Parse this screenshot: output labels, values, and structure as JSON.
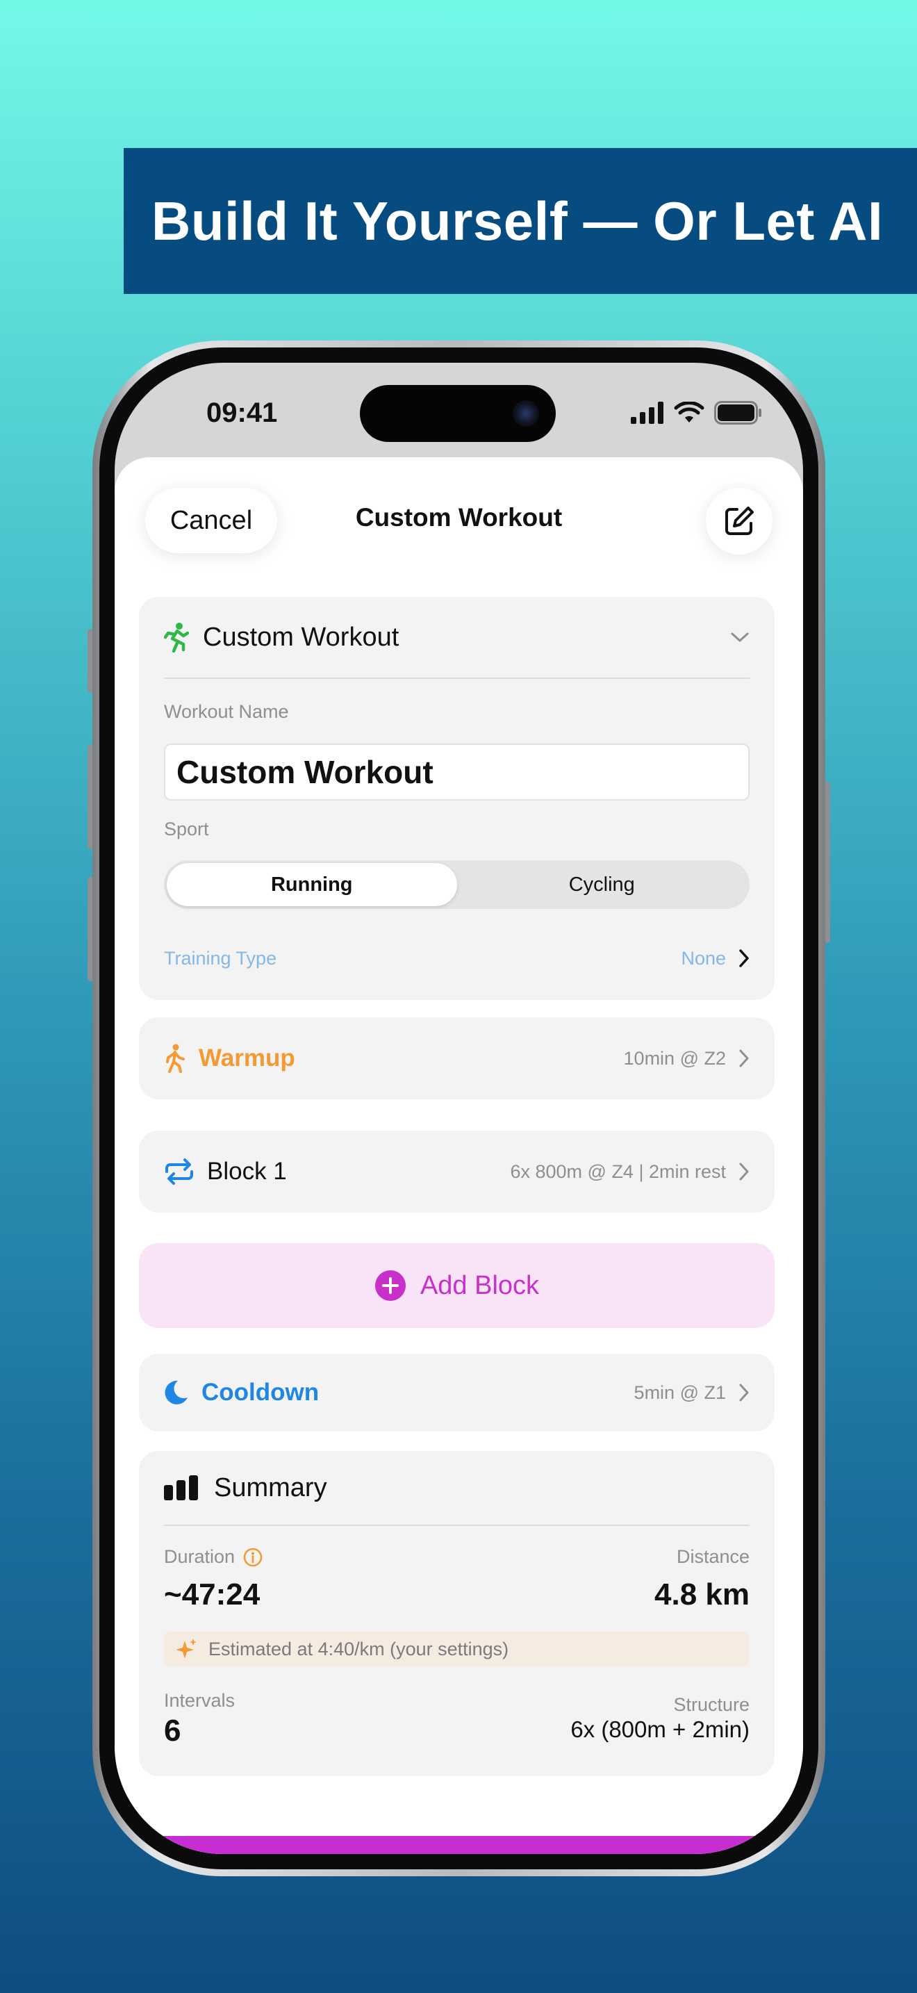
{
  "banner": {
    "headline": "Build It Yourself — Or Let AI"
  },
  "status_bar": {
    "time": "09:41"
  },
  "nav": {
    "cancel_label": "Cancel",
    "title": "Custom Workout",
    "edit_icon": "compose-icon"
  },
  "details": {
    "header_title": "Custom Workout",
    "header_icon": "running-figure-icon",
    "workout_name_label": "Workout Name",
    "workout_name_value": "Custom Workout",
    "sport_label": "Sport",
    "sport_options": [
      "Running",
      "Cycling"
    ],
    "sport_selected": "Running",
    "training_type_label": "Training Type",
    "training_type_value": "None"
  },
  "steps": {
    "warmup": {
      "name": "Warmup",
      "meta": "10min @ Z2",
      "icon": "walking-figure-icon"
    },
    "block1": {
      "name": "Block 1",
      "meta": "6x 800m @ Z4 | 2min rest",
      "icon": "repeat-icon"
    },
    "add_block": {
      "label": "Add Block",
      "icon": "plus-circle-icon"
    },
    "cooldown": {
      "name": "Cooldown",
      "meta": "5min @ Z1",
      "icon": "moon-icon"
    }
  },
  "summary": {
    "title": "Summary",
    "duration_label": "Duration",
    "duration_value": "~47:24",
    "distance_label": "Distance",
    "distance_value": "4.8 km",
    "estimate_note": "Estimated at 4:40/km (your settings)",
    "intervals_label": "Intervals",
    "intervals_value": "6",
    "structure_label": "Structure",
    "structure_value": "6x (800m + 2min)"
  },
  "colors": {
    "banner_bg": "#074c80",
    "running_green": "#2fb84a",
    "warmup_orange": "#f39a34",
    "cooldown_blue": "#1f86e4",
    "add_block_magenta": "#c731c9",
    "training_type_blue": "#83b8e6"
  }
}
